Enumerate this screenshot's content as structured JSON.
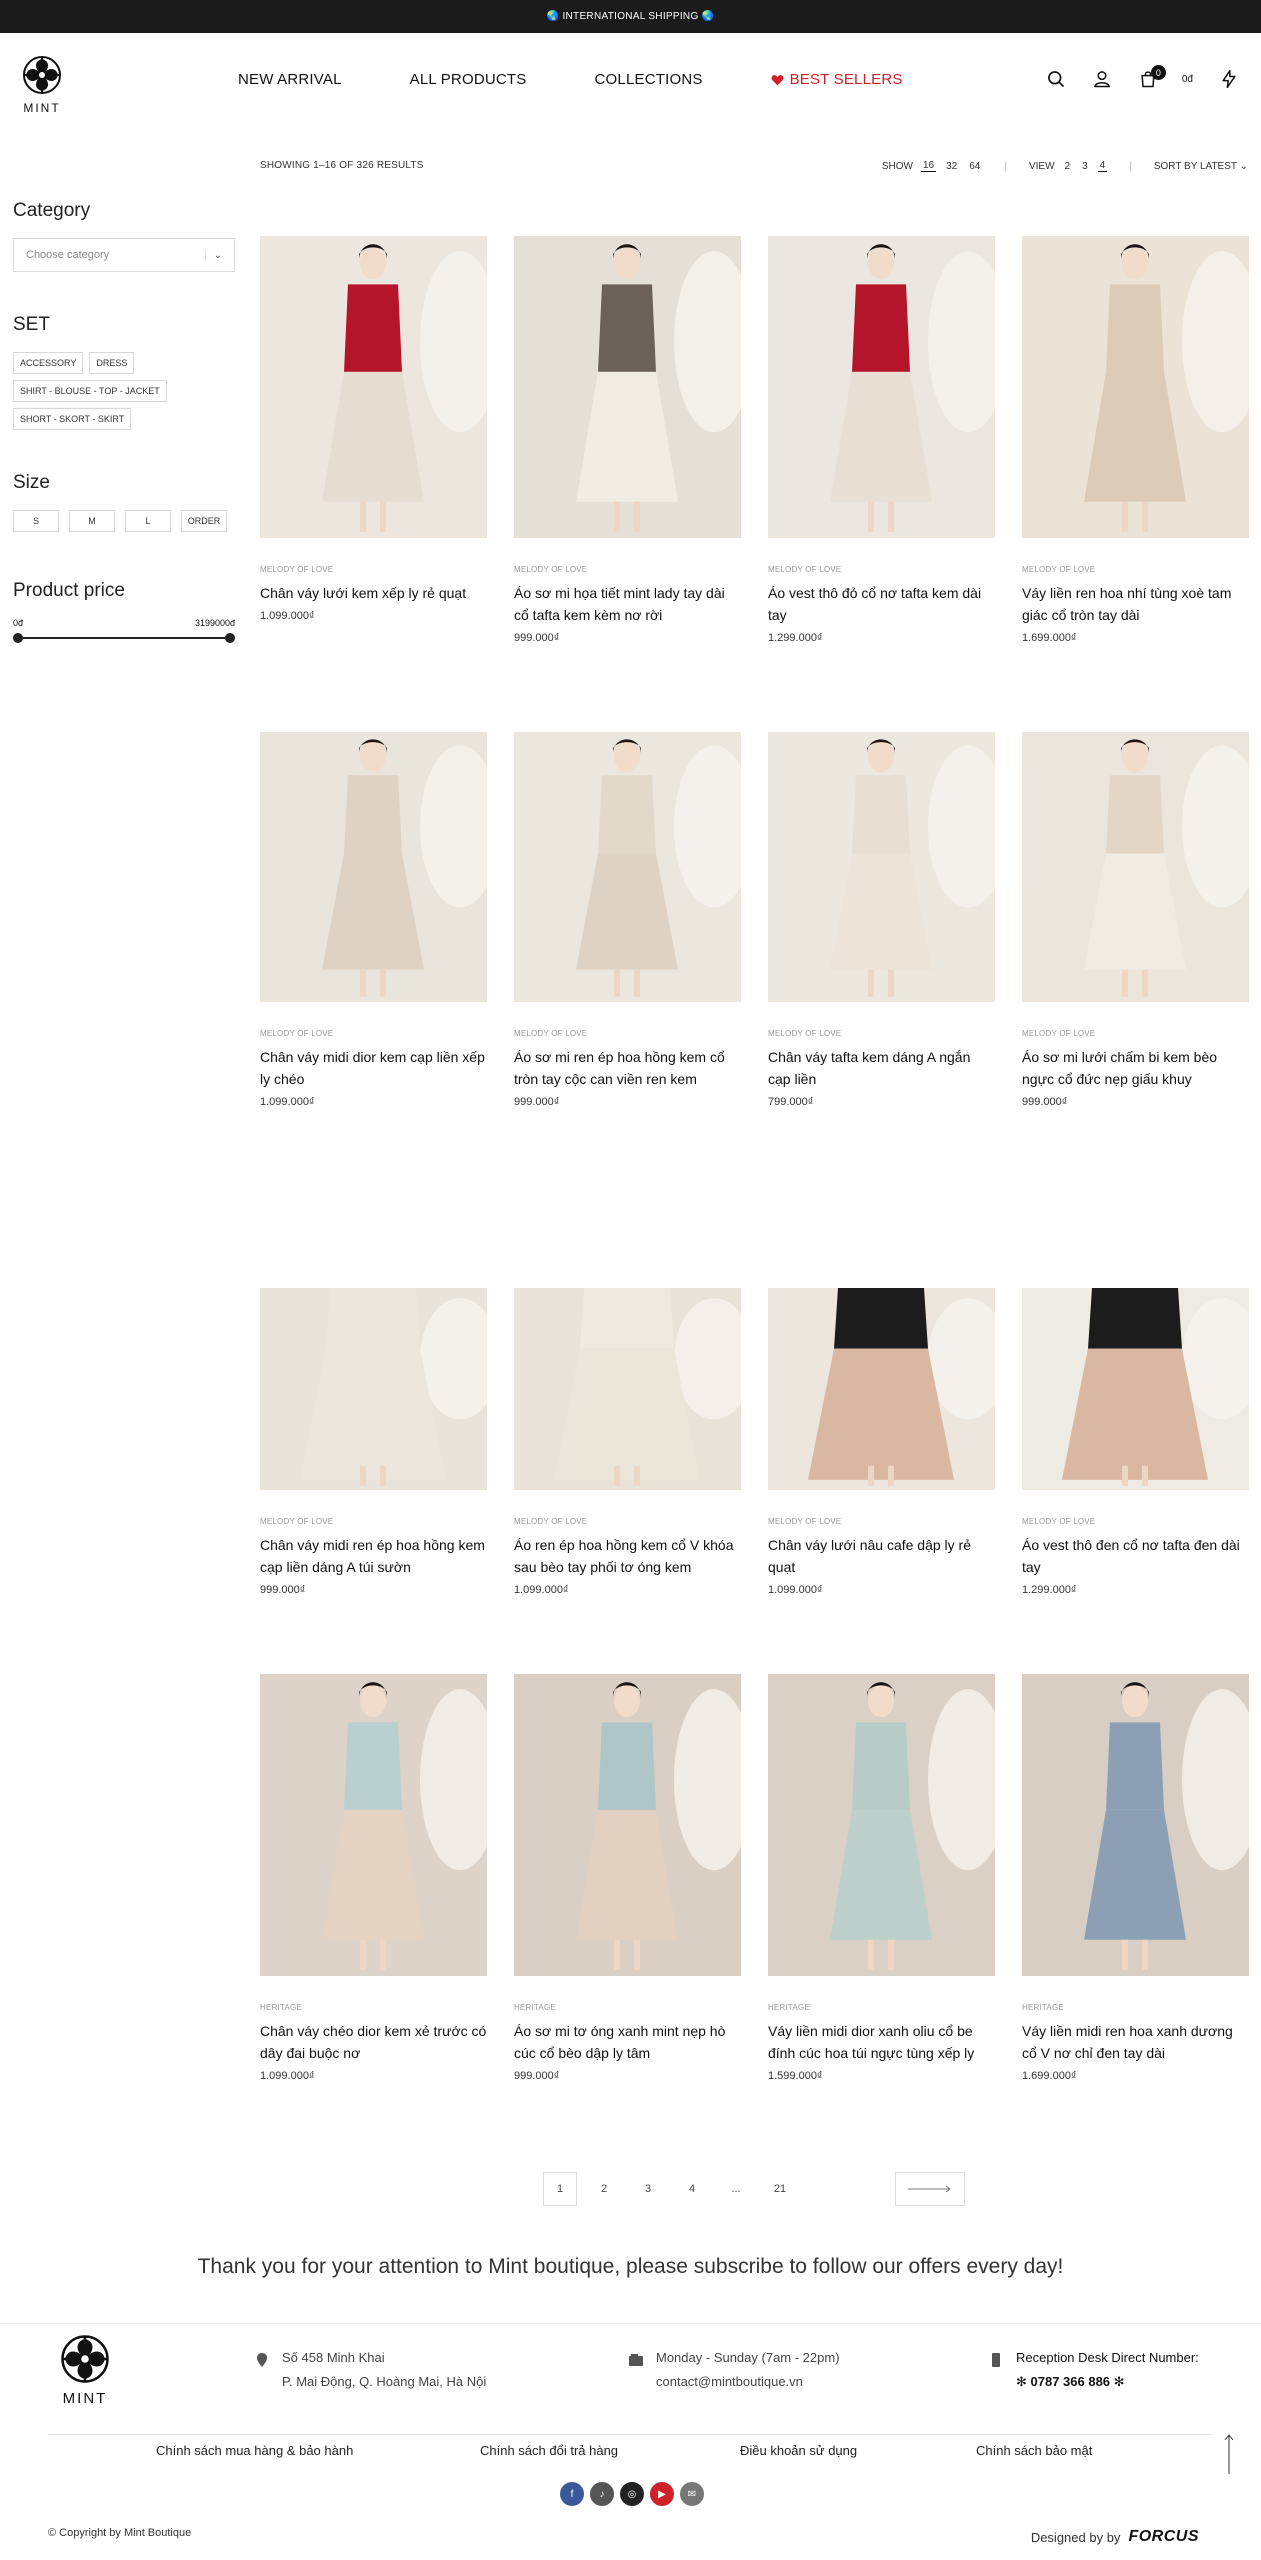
{
  "topbar": {
    "text": "🌏 INTERNATIONAL SHIPPING 🌏"
  },
  "brand": {
    "logo_text": "MINT"
  },
  "nav": {
    "items": [
      "NEW ARRIVAL",
      "ALL PRODUCTS",
      "COLLECTIONS",
      "BEST SELLERS"
    ]
  },
  "header_icons": {
    "search": "search-icon",
    "account": "user-icon",
    "cart": "cart-icon",
    "cart_count": "0",
    "cart_total": "0đ",
    "flash": "lightning-icon"
  },
  "toolbar": {
    "results": "SHOWING 1–16 OF 326 RESULTS",
    "show_label": "SHOW",
    "show_options": [
      "16",
      "32",
      "64"
    ],
    "view_label": "VIEW",
    "view_options": [
      "2",
      "3",
      "4"
    ],
    "sort_label": "SORT BY LATEST"
  },
  "sidebar": {
    "category_title": "Category",
    "category_placeholder": "Choose category",
    "set_title": "SET",
    "set_tags": [
      "ACCESSORY",
      "DRESS",
      "SHIRT - BLOUSE - TOP - JACKET",
      "SHORT - SKORT - SKIRT"
    ],
    "size_title": "Size",
    "sizes": [
      "S",
      "M",
      "L",
      "ORDER"
    ],
    "price_title": "Product price",
    "price_min": "0đ",
    "price_max": "3199000đ"
  },
  "products": [
    {
      "cat": "MELODY OF LOVE",
      "name": "Chân váy lưới kem xếp ly rẻ quạt",
      "price": "1.099.000₫"
    },
    {
      "cat": "MELODY OF LOVE",
      "name": "Áo sơ mi họa tiết mint lady tay dài cổ tafta kem kèm nơ rời",
      "price": "999.000₫"
    },
    {
      "cat": "MELODY OF LOVE",
      "name": "Áo vest thô đỏ cổ nơ tafta kem dài tay",
      "price": "1.299.000₫"
    },
    {
      "cat": "MELODY OF LOVE",
      "name": "Váy liền ren hoa nhí tùng xoè tam giác cổ tròn tay dài",
      "price": "1.699.000₫"
    },
    {
      "cat": "MELODY OF LOVE",
      "name": "Chân váy midi dior kem cạp liền xếp ly chéo",
      "price": "1.099.000₫"
    },
    {
      "cat": "MELODY OF LOVE",
      "name": "Áo sơ mi ren ép hoa hồng kem cổ tròn tay cộc can viền ren kem",
      "price": "999.000₫"
    },
    {
      "cat": "MELODY OF LOVE",
      "name": "Chân váy tafta kem dáng A ngắn cạp liền",
      "price": "799.000₫"
    },
    {
      "cat": "MELODY OF LOVE",
      "name": "Áo sơ mi lưới chấm bi kem bèo ngực cổ đức nẹp giấu khuy",
      "price": "999.000₫"
    },
    {
      "cat": "MELODY OF LOVE",
      "name": "Chân váy midi ren ép hoa hồng kem cạp liền dáng A túi sườn",
      "price": "999.000₫"
    },
    {
      "cat": "MELODY OF LOVE",
      "name": "Áo ren ép hoa hồng kem cổ V khóa sau bèo tay phối tơ óng kem",
      "price": "1.099.000₫"
    },
    {
      "cat": "MELODY OF LOVE",
      "name": "Chân váy lưới nâu cafe dập ly rẻ quạt",
      "price": "1.099.000₫"
    },
    {
      "cat": "MELODY OF LOVE",
      "name": "Áo vest thô đen cổ nơ tafta đen dài tay",
      "price": "1.299.000₫"
    },
    {
      "cat": "HERITAGE",
      "name": "Chân váy chéo dior kem xẻ trước có dây đai buộc nơ",
      "price": "1.099.000₫"
    },
    {
      "cat": "HERITAGE",
      "name": "Áo sơ mi tơ óng xanh mint nẹp hò cúc cổ bèo dập ly tâm",
      "price": "999.000₫"
    },
    {
      "cat": "HERITAGE",
      "name": "Váy liền midi dior xanh oliu cổ be đính cúc hoa túi ngực tùng xếp ly",
      "price": "1.599.000₫"
    },
    {
      "cat": "HERITAGE",
      "name": "Váy liền midi ren hoa xanh dương cổ V nơ chỉ đen tay dài",
      "price": "1.699.000₫"
    }
  ],
  "pagination": {
    "pages": [
      "1",
      "2",
      "3",
      "4",
      "...",
      "21"
    ],
    "next": "arrow-right-icon"
  },
  "subscribe": {
    "text": "Thank you for your attention to Mint boutique, please subscribe to follow our offers every day!"
  },
  "footer": {
    "address_1": "Số 458 Minh Khai",
    "address_2": "P. Mai Động, Q. Hoàng Mai, Hà Nội",
    "hours": "Monday - Sunday (7am - 22pm)",
    "email": "contact@mintboutique.vn",
    "phone_label": "Reception Desk Direct Number:",
    "phone": "✻ 0787 366 886 ✻",
    "links": [
      "Chính sách mua hàng & bảo hành",
      "Chính sách đổi trả hàng",
      "Điều khoản sử dụng",
      "Chính sách bảo mật"
    ],
    "copyright": "© Copyright by Mint Boutique",
    "designed_by": "Designed by by",
    "designer": "FORCUS"
  },
  "colors": {
    "accent": "#d0202a",
    "dark": "#1b1b1b"
  }
}
